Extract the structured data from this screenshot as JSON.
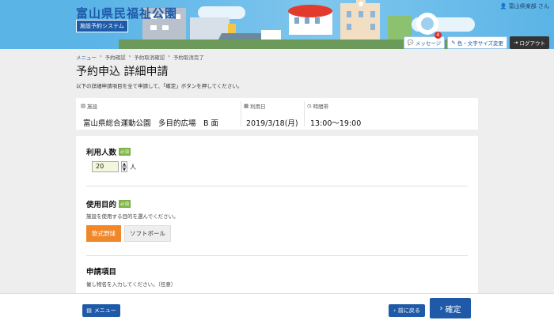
{
  "header": {
    "site_title": "富山県民福祉公園",
    "system_name": "施設予約システム",
    "user_name": "富山県楽部 さん",
    "messages_label": "メッセージ",
    "messages_count": "4",
    "display_settings_label": "色・文字サイズ変更",
    "logout_label": "ログアウト"
  },
  "breadcrumb": {
    "items": [
      "メニュー",
      "予約確認",
      "予約取消確認",
      "予約取消完了"
    ]
  },
  "page": {
    "title": "予約申込 詳細申請",
    "subtitle": "以下の詳細申請項目を全て申請して、「確定」ボタンを押してください。"
  },
  "info": {
    "facility_label": "施設",
    "facility_value": "富山県総合運動公園　多目的広場　B 面",
    "date_label": "利用日",
    "date_value": "2019/3/18(月)",
    "time_label": "時間帯",
    "time_value": "13:00〜19:00"
  },
  "form": {
    "count_title": "利用人数",
    "required_label": "必須",
    "count_value": "20",
    "count_unit": "人",
    "purpose_title": "使用目的",
    "purpose_desc": "施設を使用する目的を選んでください。",
    "purpose_options": [
      "軟式野球",
      "ソフトボール"
    ],
    "purpose_selected": "軟式野球",
    "apply_title": "申請項目",
    "apply_desc": "催し物名を入力してください。（任意）"
  },
  "footer": {
    "menu_label": "メニュー",
    "back_label": "前に戻る",
    "confirm_label": "確定"
  },
  "colors": {
    "primary": "#1e5aa8",
    "selected": "#f0882a",
    "required": "#7cb342",
    "badge": "#d9302c"
  }
}
